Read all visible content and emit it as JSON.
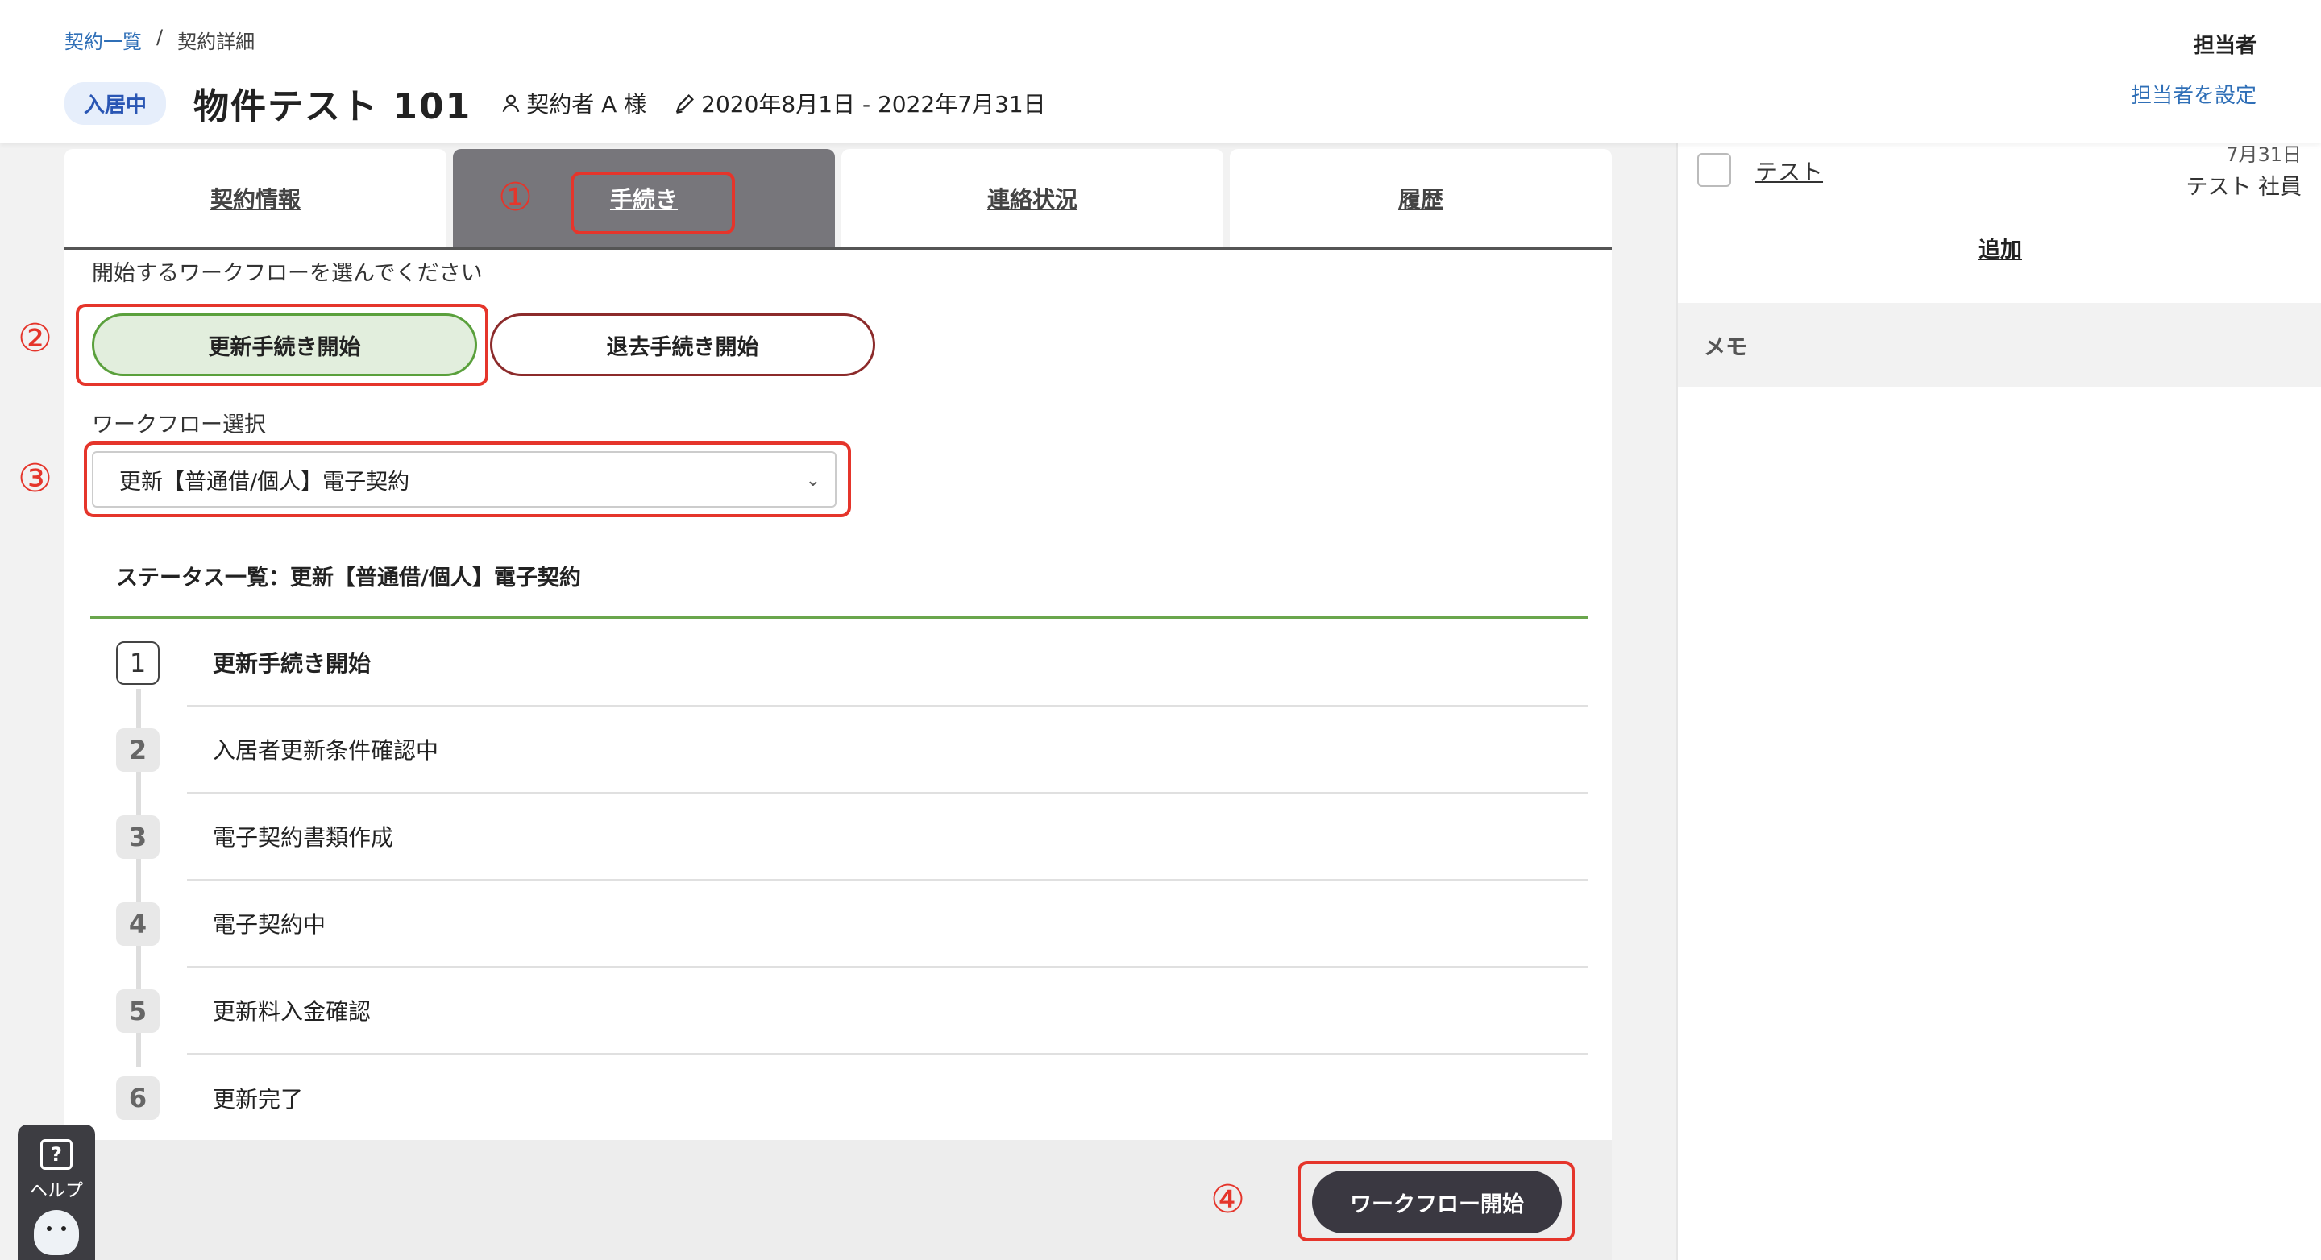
{
  "header": {
    "breadcrumb": {
      "parent": "契約一覧",
      "separator": "/",
      "current": "契約詳細"
    },
    "status_badge": "入居中",
    "property_title": "物件テスト 101",
    "contractor": "契約者 A 様",
    "period": "2020年8月1日 - 2022年7月31日",
    "assignee_label": "担当者",
    "assignee_set_link": "担当者を設定"
  },
  "tabs": [
    {
      "label": "契約情報"
    },
    {
      "label": "手続き"
    },
    {
      "label": "連絡状況"
    },
    {
      "label": "履歴"
    }
  ],
  "annotations": [
    "①",
    "②",
    "③",
    "④"
  ],
  "workflow": {
    "instruction": "開始するワークフローを選んでください",
    "renew_button": "更新手続き開始",
    "exit_button": "退去手続き開始",
    "select_label": "ワークフロー選択",
    "select_value": "更新【普通借/個人】電子契約",
    "status_heading": "ステータス一覧：更新【普通借/個人】電子契約",
    "steps": [
      {
        "num": "1",
        "label": "更新手続き開始"
      },
      {
        "num": "2",
        "label": "入居者更新条件確認中"
      },
      {
        "num": "3",
        "label": "電子契約書類作成"
      },
      {
        "num": "4",
        "label": "電子契約中"
      },
      {
        "num": "5",
        "label": "更新料入金確認"
      },
      {
        "num": "6",
        "label": "更新完了"
      }
    ],
    "start_button": "ワークフロー開始"
  },
  "sidebar": {
    "todo": {
      "name": "テスト",
      "date": "7月31日",
      "owner": "テスト 社員"
    },
    "add_link": "追加",
    "memo_label": "メモ"
  },
  "help": {
    "label": "ヘルプ",
    "icon_glyph": "?"
  },
  "colors": {
    "accent_red": "#e5352b",
    "link_blue": "#2f6fb7",
    "selected_green": "#e2eedd",
    "dark_button": "#3a3841"
  }
}
